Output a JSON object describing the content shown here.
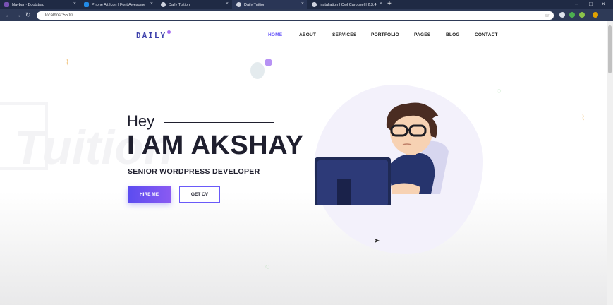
{
  "browser": {
    "tabs": [
      {
        "label": "Navbar · Bootstrap",
        "favicon_color": "#7952b3"
      },
      {
        "label": "Phone Alt Icon | Font Awesome",
        "favicon_color": "#228ae6"
      },
      {
        "label": "Daily Tuition",
        "favicon_color": "#d0d4e0"
      },
      {
        "label": "Daily Tuition",
        "favicon_color": "#d0d4e0"
      },
      {
        "label": "Installation | Owl Carousel | 2.3.4",
        "favicon_color": "#d0d4e0"
      }
    ],
    "url": "localhost:5500"
  },
  "site": {
    "logo": "DAILY",
    "nav": [
      "HOME",
      "ABOUT",
      "SERVICES",
      "PORTFOLIO",
      "PAGES",
      "BLOG",
      "CONTACT"
    ],
    "watermark": "Tuition"
  },
  "hero": {
    "greeting": "Hey",
    "name": "I AM AKSHAY",
    "title": "SENIOR WORDPRESS DEVELOPER",
    "hire_label": "HIRE ME",
    "cv_label": "GET CV"
  },
  "colors": {
    "accent": "#6a5af9",
    "button_gradient_start": "#5b4cf0",
    "button_gradient_end": "#8a5af2",
    "text_dark": "#1f1f2e"
  }
}
